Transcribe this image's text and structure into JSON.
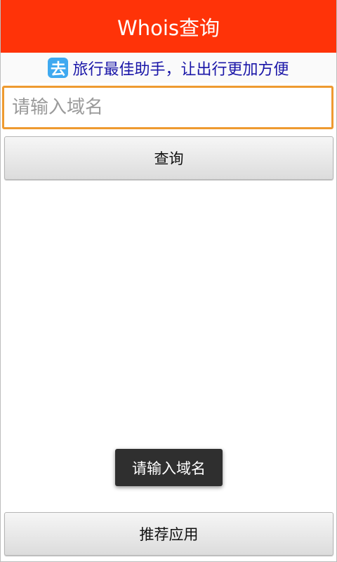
{
  "app": {
    "title": "Whois查询"
  },
  "ad": {
    "icon_glyph": "去",
    "text": "旅行最佳助手，让出行更加方便"
  },
  "search": {
    "placeholder": "请输入域名",
    "value": ""
  },
  "buttons": {
    "query_label": "查询",
    "recommend_label": "推荐应用"
  },
  "toast": {
    "message": "请输入域名"
  },
  "colors": {
    "title_bar": "#ff3308",
    "input_focus_border": "#ee9a30",
    "ad_text": "#1a16a8",
    "ad_icon": "#3fa9f0"
  }
}
